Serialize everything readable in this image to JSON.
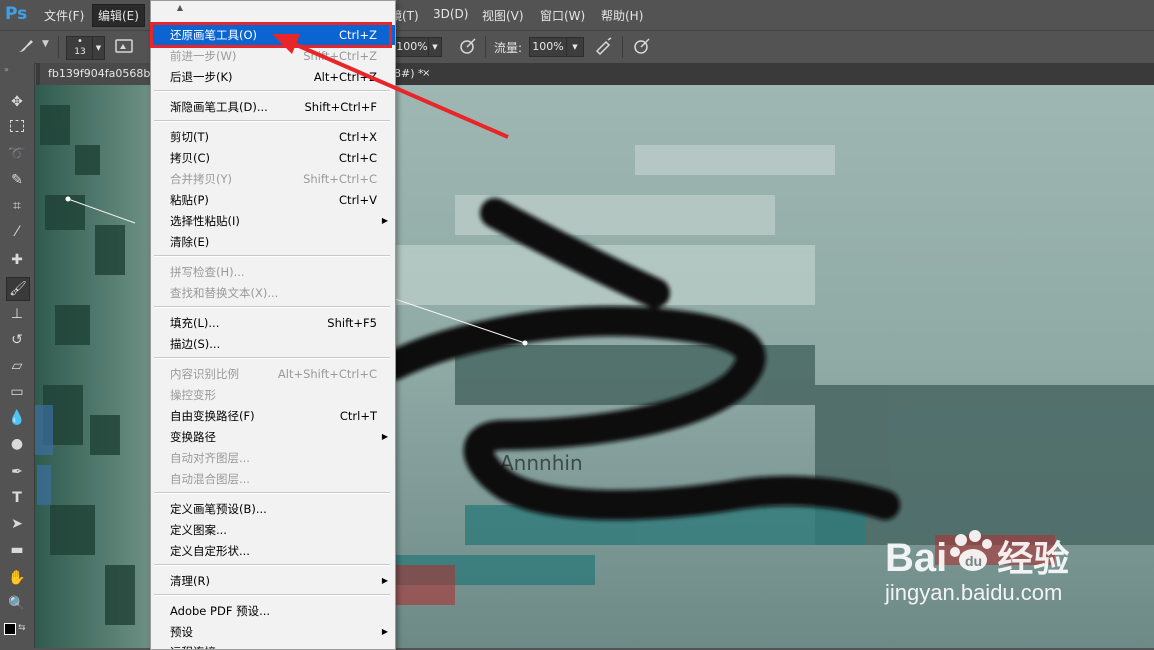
{
  "app": {
    "logo": "Ps"
  },
  "menubar": {
    "items": [
      "文件(F)",
      "编辑(E)",
      "镜(T)",
      "3D(D)",
      "视图(V)",
      "窗口(W)",
      "帮助(H)"
    ]
  },
  "options": {
    "brush_size": "13",
    "opacity_value": "100%",
    "flow_label": "流量:",
    "flow_value": "100%"
  },
  "tabs": [
    {
      "label": "fb139f904fa0568b"
    },
    {
      "label": "8#) *"
    },
    {
      "label": "×"
    }
  ],
  "edit_menu": {
    "items": [
      {
        "label": "还原画笔工具(O)",
        "shortcut": "Ctrl+Z",
        "state": "highlighted"
      },
      {
        "label": "前进一步(W)",
        "shortcut": "Shift+Ctrl+Z",
        "state": "disabled"
      },
      {
        "label": "后退一步(K)",
        "shortcut": "Alt+Ctrl+Z",
        "state": "enabled"
      },
      {
        "label": "渐隐画笔工具(D)...",
        "shortcut": "Shift+Ctrl+F",
        "state": "enabled"
      },
      {
        "label": "剪切(T)",
        "shortcut": "Ctrl+X",
        "state": "enabled"
      },
      {
        "label": "拷贝(C)",
        "shortcut": "Ctrl+C",
        "state": "enabled"
      },
      {
        "label": "合并拷贝(Y)",
        "shortcut": "Shift+Ctrl+C",
        "state": "disabled"
      },
      {
        "label": "粘贴(P)",
        "shortcut": "Ctrl+V",
        "state": "enabled"
      },
      {
        "label": "选择性粘贴(I)",
        "shortcut": "",
        "state": "submenu"
      },
      {
        "label": "清除(E)",
        "shortcut": "",
        "state": "enabled"
      },
      {
        "label": "拼写检查(H)...",
        "shortcut": "",
        "state": "disabled"
      },
      {
        "label": "查找和替换文本(X)...",
        "shortcut": "",
        "state": "disabled"
      },
      {
        "label": "填充(L)...",
        "shortcut": "Shift+F5",
        "state": "enabled"
      },
      {
        "label": "描边(S)...",
        "shortcut": "",
        "state": "enabled"
      },
      {
        "label": "内容识别比例",
        "shortcut": "Alt+Shift+Ctrl+C",
        "state": "disabled"
      },
      {
        "label": "操控变形",
        "shortcut": "",
        "state": "disabled"
      },
      {
        "label": "自由变换路径(F)",
        "shortcut": "Ctrl+T",
        "state": "enabled"
      },
      {
        "label": "变换路径",
        "shortcut": "",
        "state": "submenu"
      },
      {
        "label": "自动对齐图层...",
        "shortcut": "",
        "state": "disabled"
      },
      {
        "label": "自动混合图层...",
        "shortcut": "",
        "state": "disabled"
      },
      {
        "label": "定义画笔预设(B)...",
        "shortcut": "",
        "state": "enabled"
      },
      {
        "label": "定义图案...",
        "shortcut": "",
        "state": "enabled"
      },
      {
        "label": "定义自定形状...",
        "shortcut": "",
        "state": "enabled"
      },
      {
        "label": "清理(R)",
        "shortcut": "",
        "state": "submenu"
      },
      {
        "label": "Adobe PDF 预设...",
        "shortcut": "",
        "state": "enabled"
      },
      {
        "label": "预设",
        "shortcut": "",
        "state": "submenu"
      },
      {
        "label": "远程连接...",
        "shortcut": "",
        "state": "enabled"
      }
    ]
  },
  "watermark": {
    "brand": "Bai",
    "brand2": "经验",
    "url": "jingyan.baidu.com"
  },
  "colors": {
    "highlight": "#0a64d2",
    "annotation_red": "#e8262a",
    "ui_gray": "#535353"
  }
}
